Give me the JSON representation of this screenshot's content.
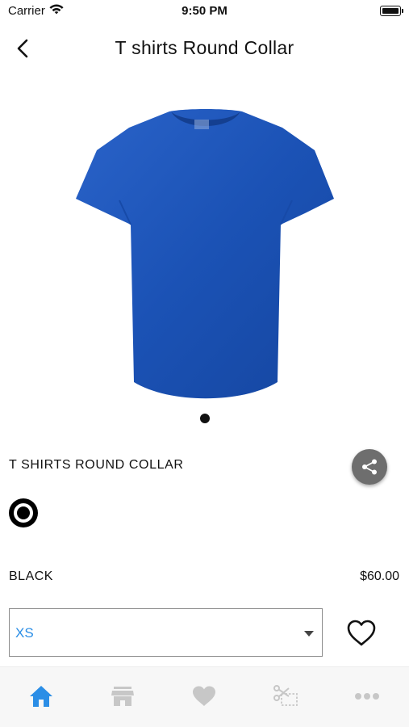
{
  "status_bar": {
    "carrier": "Carrier",
    "time": "9:50 PM"
  },
  "nav": {
    "title": "T shirts Round Collar",
    "back_icon": "chevron-left-icon"
  },
  "product": {
    "name": "T SHIRTS ROUND COLLAR",
    "image_color": "#1b52b5",
    "pager": {
      "count": 1,
      "active_index": 0
    },
    "color": {
      "label": "BLACK",
      "swatch": "#000000",
      "selected": true
    },
    "price": "$60.00",
    "size": {
      "selected": "XS",
      "accent": "#2b8ee6"
    }
  },
  "tabs": [
    {
      "icon": "home-icon",
      "active": true
    },
    {
      "icon": "store-icon",
      "active": false
    },
    {
      "icon": "heart-icon",
      "active": false
    },
    {
      "icon": "coupon-scissors-icon",
      "active": false
    },
    {
      "icon": "more-icon",
      "active": false
    }
  ],
  "colors": {
    "accent": "#2b8ee6",
    "tab_inactive": "#c7c7c7",
    "share_bg": "#6e6e6e"
  }
}
